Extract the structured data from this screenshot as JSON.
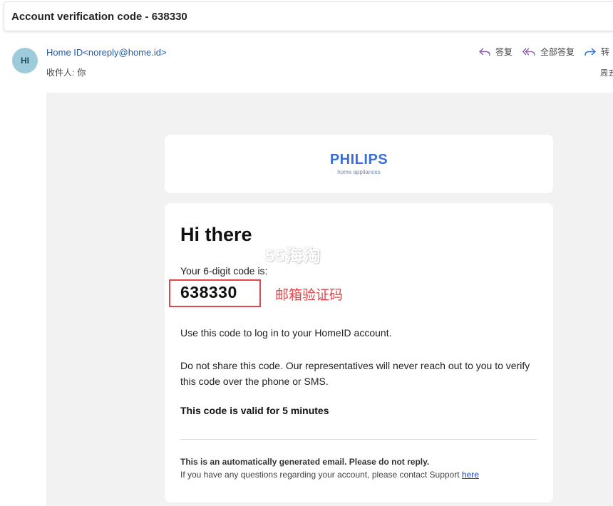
{
  "subject": "Account verification code - 638330",
  "header": {
    "avatar_initials": "HI",
    "sender": "Home ID<noreply@home.id>",
    "recipient_label": "收件人:",
    "recipient_value": "你",
    "actions": {
      "reply": "答复",
      "reply_all": "全部答复",
      "forward": "转"
    },
    "date_partial": "周五"
  },
  "email": {
    "logo": {
      "brand": "PHILIPS",
      "tagline": "home appliances"
    },
    "watermark": "55海淘",
    "greeting": "Hi there",
    "code_intro": "Your 6-digit code is:",
    "code": "638330",
    "annotation": "邮箱验证码",
    "login_text": "Use this code to log in to your HomeID account.",
    "share_text": "Do not share this code. Our representatives will never reach out to you to verify this code over the phone or SMS.",
    "valid_text": "This code is valid for 5 minutes",
    "auto_note": "This is an automatically generated email. Please do not reply.",
    "support_text": "If you have any questions regarding your account, please contact Support ",
    "support_link": "here"
  },
  "colors": {
    "accent_link": "#1e5aa8",
    "brand_blue": "#3b6fd6",
    "annotation_red": "#e0464b",
    "action_icon_purple": "#8a5aa8"
  }
}
